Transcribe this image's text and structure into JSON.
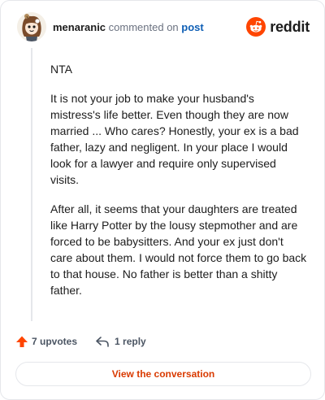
{
  "header": {
    "username": "menaranic",
    "action_text": "commented on",
    "post_link": "post",
    "brand_name": "reddit",
    "brand_color": "#ff4500",
    "avatar_icon": "snoo-avatar-icon"
  },
  "comment": {
    "paragraphs": [
      "NTA",
      "It is not your job to make your husband's mistress's life better. Even though they are now married ... Who cares? Honestly, your ex is a bad father, lazy and negligent. In your place I would look for a lawyer and require only supervised visits.",
      "After all, it seems that your daughters are treated like Harry Potter by the lousy stepmother and are forced to be babysitters. And your ex just don't care about them. I would not force them to go back to that house. No father is better than a shitty father."
    ]
  },
  "actions": {
    "upvotes_label": "7 upvotes",
    "reply_label": "1 reply",
    "upvote_icon": "upvote-arrow-icon",
    "reply_icon": "reply-arrow-icon",
    "upvote_color": "#ff4500"
  },
  "cta": {
    "label": "View the conversation",
    "color": "#d93a00"
  }
}
